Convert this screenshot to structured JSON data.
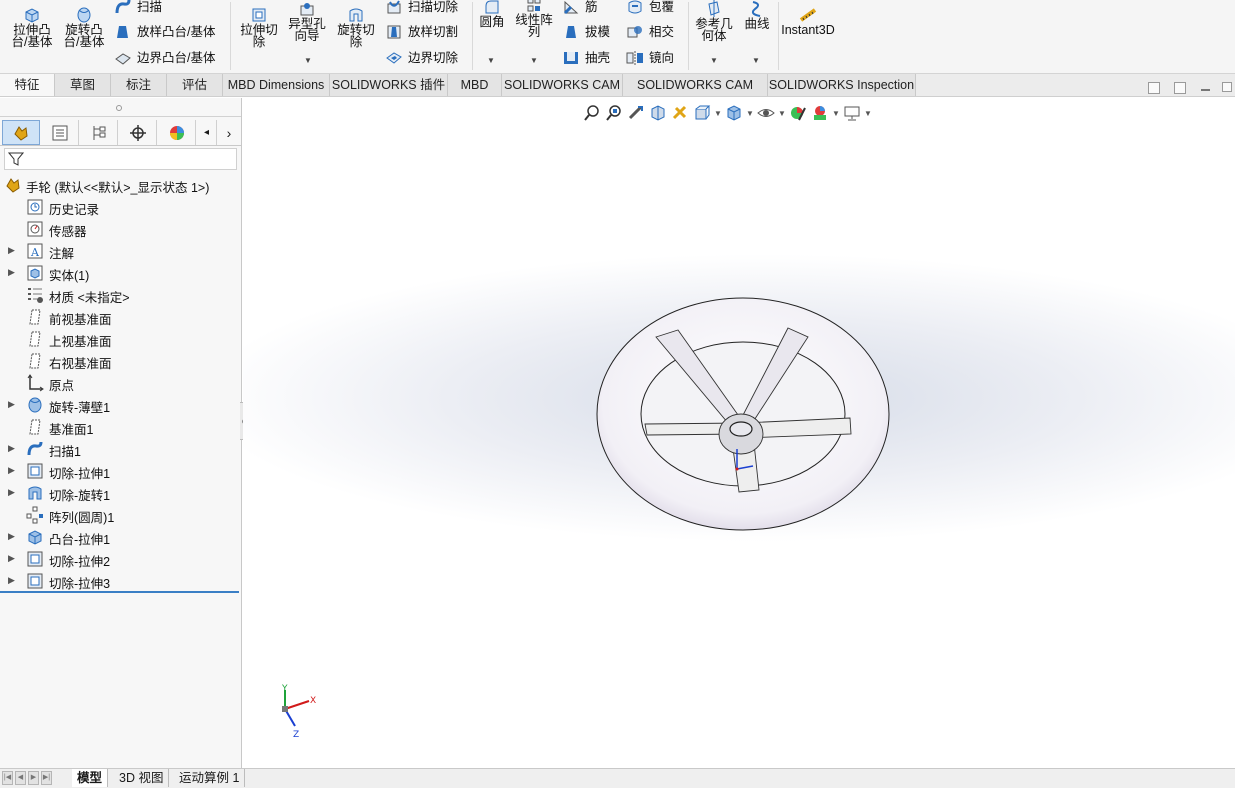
{
  "ribbon": {
    "extrude_boss": "拉伸凸\n台/基体",
    "revolve_boss": "旋转凸\n台/基体",
    "sweep": "扫描",
    "loft_boss": "放样凸台/基体",
    "boundary_boss": "边界凸台/基体",
    "extrude_cut": "拉伸切\n除",
    "hole_wizard": "异型孔\n向导",
    "revolve_cut": "旋转切\n除",
    "sweep_cut": "扫描切除",
    "loft_cut": "放样切割",
    "boundary_cut": "边界切除",
    "fillet": "圆角",
    "linear_pattern": "线性阵\n列",
    "rib": "筋",
    "draft": "拔模",
    "shell": "抽壳",
    "wrap": "包覆",
    "intersect": "相交",
    "mirror": "镜向",
    "ref_geometry": "参考几\n何体",
    "curves": "曲线",
    "instant3d": "Instant3D"
  },
  "tabs": [
    "特征",
    "草图",
    "标注",
    "评估",
    "MBD Dimensions",
    "SOLIDWORKS 插件",
    "MBD",
    "SOLIDWORKS CAM",
    "SOLIDWORKS CAM TBM",
    "SOLIDWORKS Inspection"
  ],
  "tree": {
    "root": "手轮  (默认<<默认>_显示状态 1>)",
    "items": [
      {
        "label": "历史记录",
        "icon": "history-icon",
        "arrow": false
      },
      {
        "label": "传感器",
        "icon": "sensor-icon",
        "arrow": false
      },
      {
        "label": "注解",
        "icon": "annotation-icon",
        "arrow": true
      },
      {
        "label": "实体(1)",
        "icon": "solid-bodies-icon",
        "arrow": true
      },
      {
        "label": "材质 <未指定>",
        "icon": "material-icon",
        "arrow": false
      },
      {
        "label": "前视基准面",
        "icon": "plane-icon",
        "arrow": false
      },
      {
        "label": "上视基准面",
        "icon": "plane-icon",
        "arrow": false
      },
      {
        "label": "右视基准面",
        "icon": "plane-icon",
        "arrow": false
      },
      {
        "label": "原点",
        "icon": "origin-icon",
        "arrow": false
      },
      {
        "label": "旋转-薄壁1",
        "icon": "revolve-icon",
        "arrow": true
      },
      {
        "label": "基准面1",
        "icon": "plane-icon",
        "arrow": false
      },
      {
        "label": "扫描1",
        "icon": "sweep-icon",
        "arrow": true
      },
      {
        "label": "切除-拉伸1",
        "icon": "cut-extrude-icon",
        "arrow": true
      },
      {
        "label": "切除-旋转1",
        "icon": "cut-revolve-icon",
        "arrow": true
      },
      {
        "label": "阵列(圆周)1",
        "icon": "circular-pattern-icon",
        "arrow": false
      },
      {
        "label": "凸台-拉伸1",
        "icon": "boss-extrude-icon",
        "arrow": true
      },
      {
        "label": "切除-拉伸2",
        "icon": "cut-extrude-icon",
        "arrow": true
      },
      {
        "label": "切除-拉伸3",
        "icon": "cut-extrude-icon",
        "arrow": true
      }
    ]
  },
  "triad": {
    "x": "X",
    "y": "Y",
    "z": "Z"
  },
  "bottom_tabs": [
    "模型",
    "3D 视图",
    "运动算例 1"
  ],
  "colors": {
    "accent": "#3a7fc5",
    "icon_blue": "#2a6ebd",
    "icon_gold": "#e0a516"
  }
}
